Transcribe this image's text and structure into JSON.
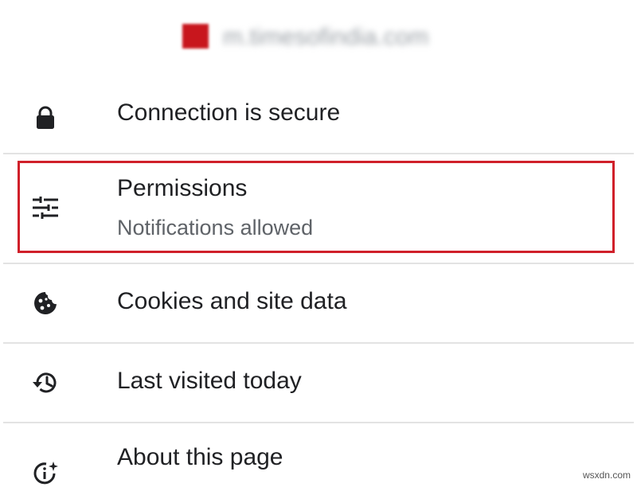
{
  "site": {
    "favicon_color": "#c8161d",
    "url": "m.timesofindia.com"
  },
  "rows": [
    {
      "icon": "lock-icon",
      "title": "Connection is secure"
    },
    {
      "icon": "tune-icon",
      "title": "Permissions",
      "subtitle": "Notifications allowed",
      "highlighted": true
    },
    {
      "icon": "cookie-icon",
      "title": "Cookies and site data"
    },
    {
      "icon": "history-icon",
      "title": "Last visited today"
    },
    {
      "icon": "info-sparkle-icon",
      "title": "About this page"
    }
  ],
  "colors": {
    "highlight_border": "#d0202a",
    "text_primary": "#202124",
    "text_secondary": "#5f6368",
    "divider": "#e3e3e3"
  },
  "watermark": "wsxdn.com"
}
